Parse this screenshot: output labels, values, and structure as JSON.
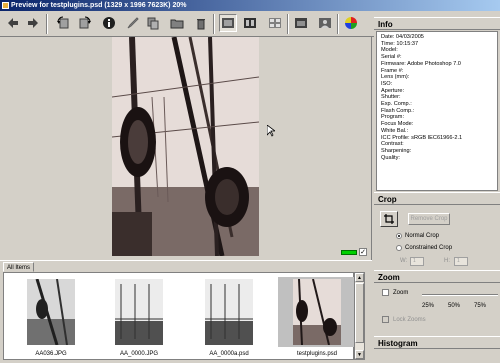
{
  "window": {
    "title": "Preview for testplugins.psd (1329 x 1996 7623K) 20%"
  },
  "toolbar": {
    "buttons": [
      {
        "name": "back-arrow-icon"
      },
      {
        "name": "forward-arrow-icon"
      },
      {
        "name": "rotate-left-icon"
      },
      {
        "name": "rotate-right-icon"
      },
      {
        "name": "info-icon"
      },
      {
        "name": "pen-icon"
      },
      {
        "name": "copy-icon"
      },
      {
        "name": "folder-icon"
      },
      {
        "name": "trash-icon"
      },
      {
        "name": "view-single-icon"
      },
      {
        "name": "view-strip-icon"
      },
      {
        "name": "view-grid-icon"
      },
      {
        "name": "view-compare-icon"
      },
      {
        "name": "view-person-icon"
      },
      {
        "name": "color-wheel-icon"
      }
    ]
  },
  "browser": {
    "tab_label": "All Items",
    "thumbnails": [
      {
        "filename": "AA036.JPG",
        "selected": false
      },
      {
        "filename": "AA_0000.JPG",
        "selected": false
      },
      {
        "filename": "AA_0000a.psd",
        "selected": false
      },
      {
        "filename": "testplugins.psd",
        "selected": true
      }
    ]
  },
  "info": {
    "header": "Info",
    "lines": [
      "Date: 04/03/2005",
      "Time: 10:15:37",
      "Model:",
      "Serial #:",
      "Firmware: Adobe Photoshop 7.0",
      "Frame #:",
      "Lens (mm):",
      "ISO:",
      "Aperture:",
      "Shutter:",
      "Exp. Comp.:",
      "Flash Comp.:",
      "Program:",
      "Focus Mode:",
      "White Bal.:",
      "ICC Profile: sRGB IEC61966-2.1",
      "Contrast:",
      "Sharpening:",
      "Quality:"
    ]
  },
  "crop": {
    "header": "Crop",
    "remove_label": "Remove Crop",
    "normal_label": "Normal Crop",
    "constrained_label": "Constrained Crop",
    "w_label": "W:",
    "w_value": "1",
    "h_label": "H:",
    "h_value": "1",
    "selected": "normal"
  },
  "zoom": {
    "header": "Zoom",
    "zoom_label": "Zoom",
    "ticks": [
      "25%",
      "50%",
      "75%"
    ],
    "lock_label": "Lock Zooms"
  },
  "histogram": {
    "header": "Histogram"
  },
  "colors": {
    "titlebar_start": "#0a246a",
    "titlebar_end": "#a6caf0",
    "status_green": "#00d000"
  }
}
